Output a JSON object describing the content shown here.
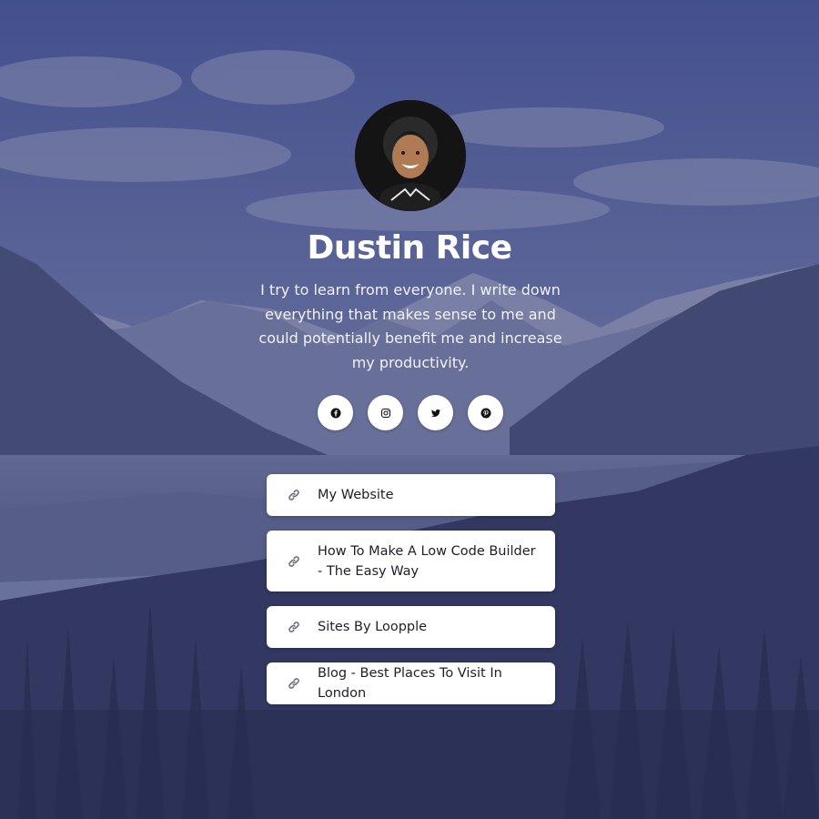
{
  "profile": {
    "name": "Dustin Rice",
    "bio": "I try to learn from everyone. I write down everything that makes sense to me and could potentially benefit me and increase my productivity."
  },
  "socials": [
    {
      "icon": "facebook-icon"
    },
    {
      "icon": "instagram-icon"
    },
    {
      "icon": "twitter-icon"
    },
    {
      "icon": "pinterest-icon"
    }
  ],
  "links": [
    {
      "label": "My Website",
      "icon": "link-icon"
    },
    {
      "label": "How To Make A Low Code Builder - The Easy Way",
      "icon": "link-icon"
    },
    {
      "label": "Sites By Loopple",
      "icon": "link-icon"
    },
    {
      "label": "Blog - Best Places To Visit In London",
      "icon": "link-icon"
    }
  ],
  "colors": {
    "overlay": "#242660",
    "card": "#ffffff",
    "text_light": "#ffffff",
    "link_text": "#1e1e2a",
    "link_icon": "#6b6d80"
  }
}
